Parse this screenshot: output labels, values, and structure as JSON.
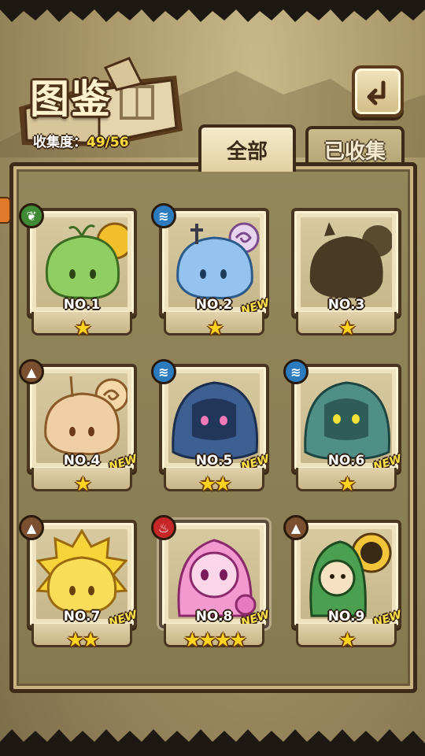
{
  "header": {
    "title": "图鉴",
    "collection_label": "收集度：",
    "collection_value": "49/56"
  },
  "tabs": [
    {
      "label": "全部",
      "selected": true
    },
    {
      "label": "已收集",
      "selected": false
    }
  ],
  "cards": [
    {
      "number": "NO.1",
      "element": "grass",
      "stars": "★",
      "new": "",
      "art": "green slime mushroom with sun"
    },
    {
      "number": "NO.2",
      "element": "water",
      "stars": "★",
      "new": "NEW",
      "art": "blue slime with swirl"
    },
    {
      "number": "NO.3",
      "element": "",
      "stars": "★",
      "new": "",
      "art": "unknown silhouette"
    },
    {
      "number": "NO.4",
      "element": "earth",
      "stars": "★",
      "new": "NEW",
      "art": "beige slime with swirl"
    },
    {
      "number": "NO.5",
      "element": "water",
      "stars": "★★",
      "new": "NEW",
      "art": "dark blue ghost girl"
    },
    {
      "number": "NO.6",
      "element": "water",
      "stars": "★",
      "new": "NEW",
      "art": "teal ghost girl"
    },
    {
      "number": "NO.7",
      "element": "earth",
      "stars": "★★",
      "new": "NEW",
      "art": "yellow slime with sun"
    },
    {
      "number": "NO.8",
      "element": "fire",
      "stars": "★★★★",
      "new": "NEW",
      "art": "pink slime girl"
    },
    {
      "number": "NO.9",
      "element": "earth",
      "stars": "★",
      "new": "NEW",
      "art": "green haired girl with sunflower"
    }
  ],
  "colors": {
    "grass": "#3f8a35",
    "water": "#2c7bbf",
    "earth": "#7a5030",
    "fire": "#c8272a",
    "star": "#ffd320",
    "new": "#ffe14a"
  }
}
